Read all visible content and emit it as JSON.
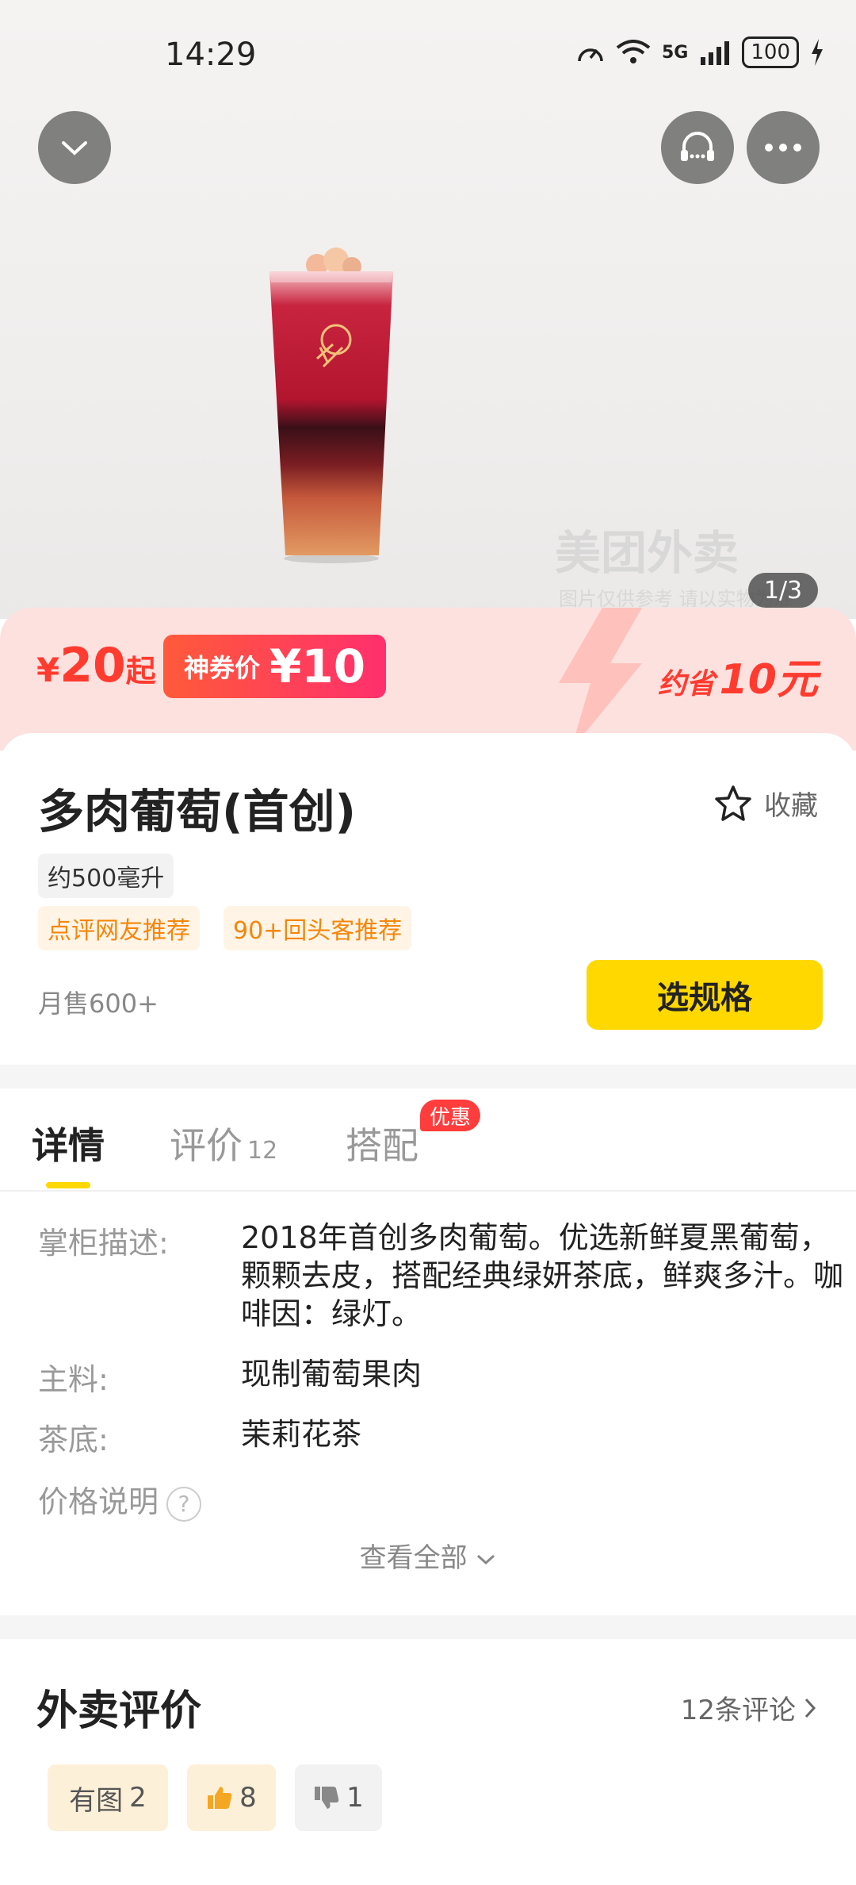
{
  "status_bar": {
    "time": "14:29",
    "network": "5G",
    "battery": "100"
  },
  "hero": {
    "image_counter": "1/3",
    "watermark": "美团外卖",
    "watermark_note": "图片仅供参考 请以实物为准"
  },
  "price": {
    "currency": "¥",
    "original_value": "20",
    "original_suffix": "起",
    "coupon_label": "神券价",
    "coupon_price": "¥10",
    "save_prefix": "约省",
    "save_amount": "10元"
  },
  "product": {
    "name": "多肉葡萄(首创)",
    "favorite_label": "收藏",
    "volume": "约500毫升",
    "tags": [
      "点评网友推荐",
      "90+回头客推荐"
    ],
    "monthly_sales": "月售600+",
    "select_button": "选规格"
  },
  "tabs": [
    {
      "label": "详情",
      "active": true
    },
    {
      "label": "评价",
      "count": "12"
    },
    {
      "label": "搭配",
      "badge": "优惠"
    }
  ],
  "details": {
    "description_label": "掌柜描述:",
    "description_value": "2018年首创多肉葡萄。优选新鲜夏黑葡萄，颗颗去皮，搭配经典绿妍茶底，鲜爽多汁。咖啡因：绿灯。",
    "main_label": "主料:",
    "main_value": "现制葡萄果肉",
    "tea_label": "茶底:",
    "tea_value": "茉莉花茶",
    "price_note_label": "价格说明",
    "view_all": "查看全部"
  },
  "reviews": {
    "title": "外卖评价",
    "count_link": "12条评论",
    "filters": [
      {
        "label": "有图",
        "count": "2"
      },
      {
        "label": "",
        "count": "8",
        "icon": "thumbs-up-icon"
      },
      {
        "label": "",
        "count": "1",
        "icon": "thumbs-down-icon"
      }
    ]
  },
  "colors": {
    "accent_yellow": "#FFD800",
    "price_red": "#FF3B2F",
    "tag_orange": "#F5860B"
  }
}
